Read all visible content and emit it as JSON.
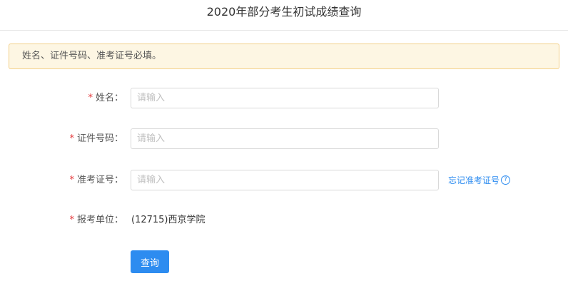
{
  "page": {
    "title": "2020年部分考生初试成绩查询"
  },
  "notice": {
    "text": "姓名、证件号码、准考证号必填。"
  },
  "form": {
    "required_mark": "*",
    "name": {
      "label": "姓名：",
      "placeholder": "请输入",
      "value": ""
    },
    "id_number": {
      "label": "证件号码：",
      "placeholder": "请输入",
      "value": ""
    },
    "exam_number": {
      "label": "准考证号：",
      "placeholder": "请输入",
      "value": "",
      "forgot_link": "忘记准考证号",
      "help_icon": "question-circle-icon"
    },
    "institution": {
      "label": "报考单位：",
      "value": "(12715)西京学院"
    },
    "submit_label": "查询"
  },
  "colors": {
    "primary": "#2d8cf0",
    "required": "#e4393c",
    "notice_bg": "#fdf6e3",
    "notice_border": "#f3d08a"
  }
}
